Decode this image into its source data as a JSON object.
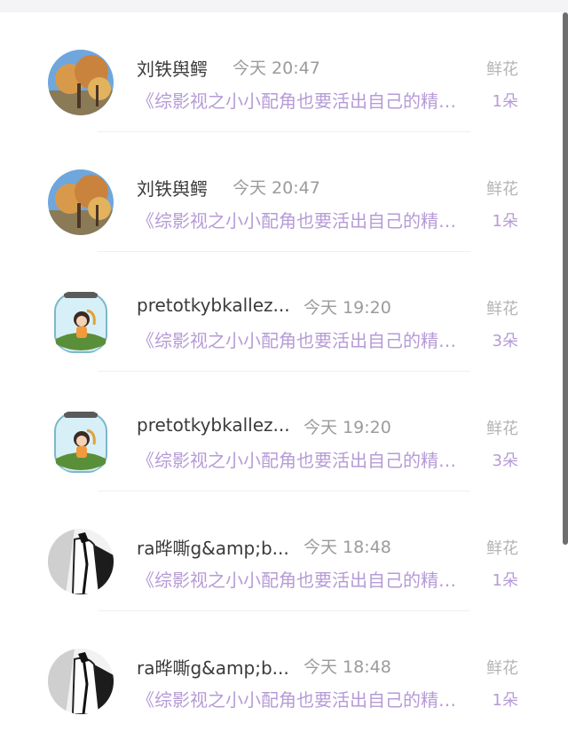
{
  "gifts": [
    {
      "name": "刘铁舆鳄",
      "time": "今天 20:47",
      "gift_label": "鲜花",
      "book": "《综影视之小小配角也要活出自己的精彩》",
      "count": "1朵",
      "avatar": "autumn-tree-avatar"
    },
    {
      "name": "刘铁舆鳄",
      "time": "今天 20:47",
      "gift_label": "鲜花",
      "book": "《综影视之小小配角也要活出自己的精彩》",
      "count": "1朵",
      "avatar": "autumn-tree-avatar"
    },
    {
      "name": "pretotkybkallez...",
      "time": "今天 19:20",
      "gift_label": "鲜花",
      "book": "《综影视之小小配角也要活出自己的精彩》",
      "count": "3朵",
      "avatar": "girl-in-jar-avatar"
    },
    {
      "name": "pretotkybkallez...",
      "time": "今天 19:20",
      "gift_label": "鲜花",
      "book": "《综影视之小小配角也要活出自己的精彩》",
      "count": "3朵",
      "avatar": "girl-in-jar-avatar"
    },
    {
      "name": "ra晔嘶g&amp;b...",
      "time": "今天 18:48",
      "gift_label": "鲜花",
      "book": "《综影视之小小配角也要活出自己的精彩》",
      "count": "1朵",
      "avatar": "sketch-figure-avatar"
    },
    {
      "name": "ra晔嘶g&amp;b...",
      "time": "今天 18:48",
      "gift_label": "鲜花",
      "book": "《综影视之小小配角也要活出自己的精彩》",
      "count": "1朵",
      "avatar": "sketch-figure-avatar"
    }
  ],
  "colors": {
    "accent": "#b69bd6",
    "name": "#3a3a3a",
    "muted": "#9b9b9b",
    "scrollbar": "#6e6e6e"
  }
}
